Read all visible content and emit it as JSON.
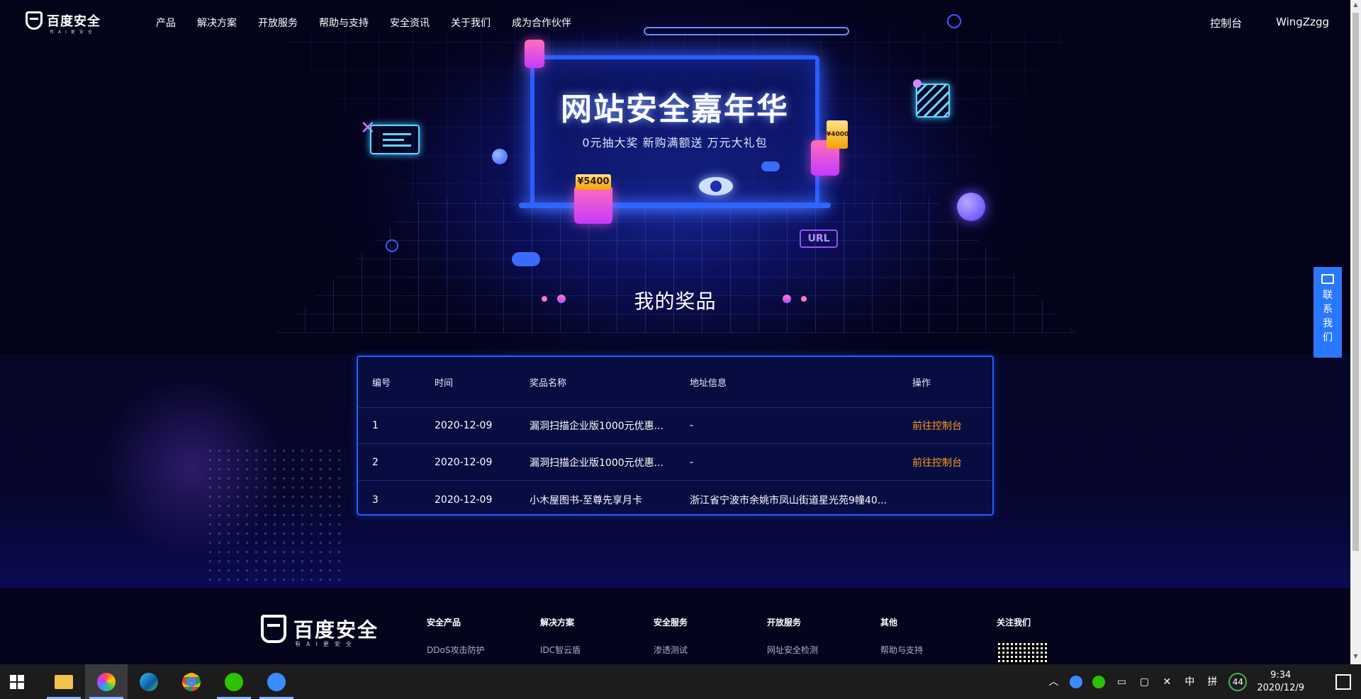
{
  "nav": {
    "logo_text": "百度安全",
    "logo_sub": "有AI更安全",
    "items": [
      "产品",
      "解决方案",
      "开放服务",
      "帮助与支持",
      "安全资讯",
      "关于我们",
      "成为合作伙伴"
    ],
    "console": "控制台",
    "username": "WingZzgg"
  },
  "hero": {
    "title": "网站安全嘉年华",
    "subtitle": "0元抽大奖  新购满额送  万元大礼包",
    "coupon_big": "¥5400",
    "coupon_small": "¥4000",
    "url_badge": "URL",
    "section_title": "我的奖品"
  },
  "table": {
    "headers": {
      "id": "编号",
      "time": "时间",
      "prize": "奖品名称",
      "address": "地址信息",
      "action": "操作"
    },
    "rows": [
      {
        "id": "1",
        "time": "2020-12-09",
        "prize": "漏洞扫描企业版1000元优惠...",
        "address": "-",
        "action": "前往控制台"
      },
      {
        "id": "2",
        "time": "2020-12-09",
        "prize": "漏洞扫描企业版1000元优惠...",
        "address": "-",
        "action": "前往控制台"
      },
      {
        "id": "3",
        "time": "2020-12-09",
        "prize": "小木屋图书-至尊先享月卡",
        "address": "浙江省宁波市余姚市凤山街道星光苑9幢40...",
        "action": ""
      }
    ]
  },
  "contact": {
    "label": "联系我们"
  },
  "footer": {
    "logo_text": "百度安全",
    "logo_sub": "有AI更安全",
    "columns": [
      {
        "title": "安全产品",
        "first": "DDoS攻击防护"
      },
      {
        "title": "解决方案",
        "first": "IDC智云盾"
      },
      {
        "title": "安全服务",
        "first": "渗透测试"
      },
      {
        "title": "开放服务",
        "first": "网址安全检测"
      },
      {
        "title": "其他",
        "first": "帮助与支持"
      },
      {
        "title": "关注我们",
        "first": ""
      }
    ]
  },
  "taskbar": {
    "apps": [
      "file-explorer",
      "browser-colorful",
      "edge",
      "chrome",
      "wechat",
      "feishu"
    ],
    "tray": {
      "ime_lang": "中",
      "ime_mode": "拼",
      "badge": "44",
      "time": "9:34",
      "date": "2020/12/9"
    }
  },
  "colors": {
    "accent": "#2a5cff",
    "action": "#ff9a1f",
    "contact": "#2a78ff"
  }
}
